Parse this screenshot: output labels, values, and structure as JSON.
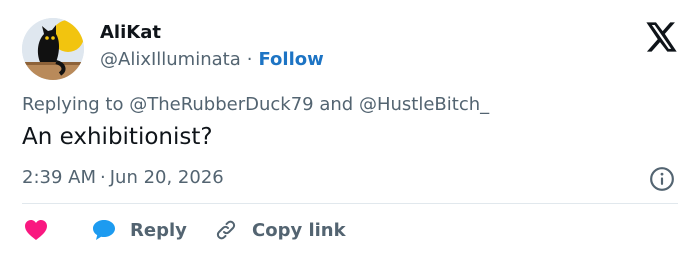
{
  "author": {
    "display_name": "AliKat",
    "handle": "@AlixIlluminata",
    "follow_label": "Follow"
  },
  "separator": "·",
  "reply_context": {
    "prefix": "Replying to",
    "mention_1": "@TheRubberDuck79",
    "conjunction": "and",
    "mention_2": "@HustleBitch_"
  },
  "tweet": {
    "text": "An exhibitionist?",
    "time": "2:39 AM",
    "date": "Jun 20, 2026"
  },
  "actions": {
    "like_icon": "heart-icon",
    "reply_label": "Reply",
    "reply_icon": "speech-bubble-icon",
    "copy_link_label": "Copy link",
    "copy_link_icon": "link-icon"
  },
  "colors": {
    "text_primary": "#0f1419",
    "text_secondary": "#536471",
    "follow": "#1d74c4",
    "like": "#f91880",
    "reply_bubble": "#1d9bf0"
  }
}
